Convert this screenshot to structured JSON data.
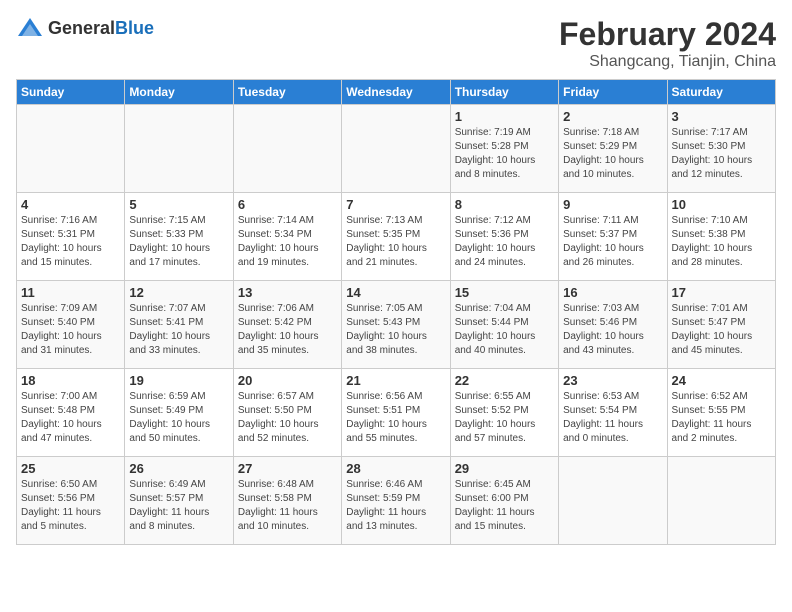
{
  "header": {
    "logo_general": "General",
    "logo_blue": "Blue",
    "title": "February 2024",
    "subtitle": "Shangcang, Tianjin, China"
  },
  "days_of_week": [
    "Sunday",
    "Monday",
    "Tuesday",
    "Wednesday",
    "Thursday",
    "Friday",
    "Saturday"
  ],
  "weeks": [
    [
      {
        "num": "",
        "info": ""
      },
      {
        "num": "",
        "info": ""
      },
      {
        "num": "",
        "info": ""
      },
      {
        "num": "",
        "info": ""
      },
      {
        "num": "1",
        "info": "Sunrise: 7:19 AM\nSunset: 5:28 PM\nDaylight: 10 hours\nand 8 minutes."
      },
      {
        "num": "2",
        "info": "Sunrise: 7:18 AM\nSunset: 5:29 PM\nDaylight: 10 hours\nand 10 minutes."
      },
      {
        "num": "3",
        "info": "Sunrise: 7:17 AM\nSunset: 5:30 PM\nDaylight: 10 hours\nand 12 minutes."
      }
    ],
    [
      {
        "num": "4",
        "info": "Sunrise: 7:16 AM\nSunset: 5:31 PM\nDaylight: 10 hours\nand 15 minutes."
      },
      {
        "num": "5",
        "info": "Sunrise: 7:15 AM\nSunset: 5:33 PM\nDaylight: 10 hours\nand 17 minutes."
      },
      {
        "num": "6",
        "info": "Sunrise: 7:14 AM\nSunset: 5:34 PM\nDaylight: 10 hours\nand 19 minutes."
      },
      {
        "num": "7",
        "info": "Sunrise: 7:13 AM\nSunset: 5:35 PM\nDaylight: 10 hours\nand 21 minutes."
      },
      {
        "num": "8",
        "info": "Sunrise: 7:12 AM\nSunset: 5:36 PM\nDaylight: 10 hours\nand 24 minutes."
      },
      {
        "num": "9",
        "info": "Sunrise: 7:11 AM\nSunset: 5:37 PM\nDaylight: 10 hours\nand 26 minutes."
      },
      {
        "num": "10",
        "info": "Sunrise: 7:10 AM\nSunset: 5:38 PM\nDaylight: 10 hours\nand 28 minutes."
      }
    ],
    [
      {
        "num": "11",
        "info": "Sunrise: 7:09 AM\nSunset: 5:40 PM\nDaylight: 10 hours\nand 31 minutes."
      },
      {
        "num": "12",
        "info": "Sunrise: 7:07 AM\nSunset: 5:41 PM\nDaylight: 10 hours\nand 33 minutes."
      },
      {
        "num": "13",
        "info": "Sunrise: 7:06 AM\nSunset: 5:42 PM\nDaylight: 10 hours\nand 35 minutes."
      },
      {
        "num": "14",
        "info": "Sunrise: 7:05 AM\nSunset: 5:43 PM\nDaylight: 10 hours\nand 38 minutes."
      },
      {
        "num": "15",
        "info": "Sunrise: 7:04 AM\nSunset: 5:44 PM\nDaylight: 10 hours\nand 40 minutes."
      },
      {
        "num": "16",
        "info": "Sunrise: 7:03 AM\nSunset: 5:46 PM\nDaylight: 10 hours\nand 43 minutes."
      },
      {
        "num": "17",
        "info": "Sunrise: 7:01 AM\nSunset: 5:47 PM\nDaylight: 10 hours\nand 45 minutes."
      }
    ],
    [
      {
        "num": "18",
        "info": "Sunrise: 7:00 AM\nSunset: 5:48 PM\nDaylight: 10 hours\nand 47 minutes."
      },
      {
        "num": "19",
        "info": "Sunrise: 6:59 AM\nSunset: 5:49 PM\nDaylight: 10 hours\nand 50 minutes."
      },
      {
        "num": "20",
        "info": "Sunrise: 6:57 AM\nSunset: 5:50 PM\nDaylight: 10 hours\nand 52 minutes."
      },
      {
        "num": "21",
        "info": "Sunrise: 6:56 AM\nSunset: 5:51 PM\nDaylight: 10 hours\nand 55 minutes."
      },
      {
        "num": "22",
        "info": "Sunrise: 6:55 AM\nSunset: 5:52 PM\nDaylight: 10 hours\nand 57 minutes."
      },
      {
        "num": "23",
        "info": "Sunrise: 6:53 AM\nSunset: 5:54 PM\nDaylight: 11 hours\nand 0 minutes."
      },
      {
        "num": "24",
        "info": "Sunrise: 6:52 AM\nSunset: 5:55 PM\nDaylight: 11 hours\nand 2 minutes."
      }
    ],
    [
      {
        "num": "25",
        "info": "Sunrise: 6:50 AM\nSunset: 5:56 PM\nDaylight: 11 hours\nand 5 minutes."
      },
      {
        "num": "26",
        "info": "Sunrise: 6:49 AM\nSunset: 5:57 PM\nDaylight: 11 hours\nand 8 minutes."
      },
      {
        "num": "27",
        "info": "Sunrise: 6:48 AM\nSunset: 5:58 PM\nDaylight: 11 hours\nand 10 minutes."
      },
      {
        "num": "28",
        "info": "Sunrise: 6:46 AM\nSunset: 5:59 PM\nDaylight: 11 hours\nand 13 minutes."
      },
      {
        "num": "29",
        "info": "Sunrise: 6:45 AM\nSunset: 6:00 PM\nDaylight: 11 hours\nand 15 minutes."
      },
      {
        "num": "",
        "info": ""
      },
      {
        "num": "",
        "info": ""
      }
    ]
  ]
}
